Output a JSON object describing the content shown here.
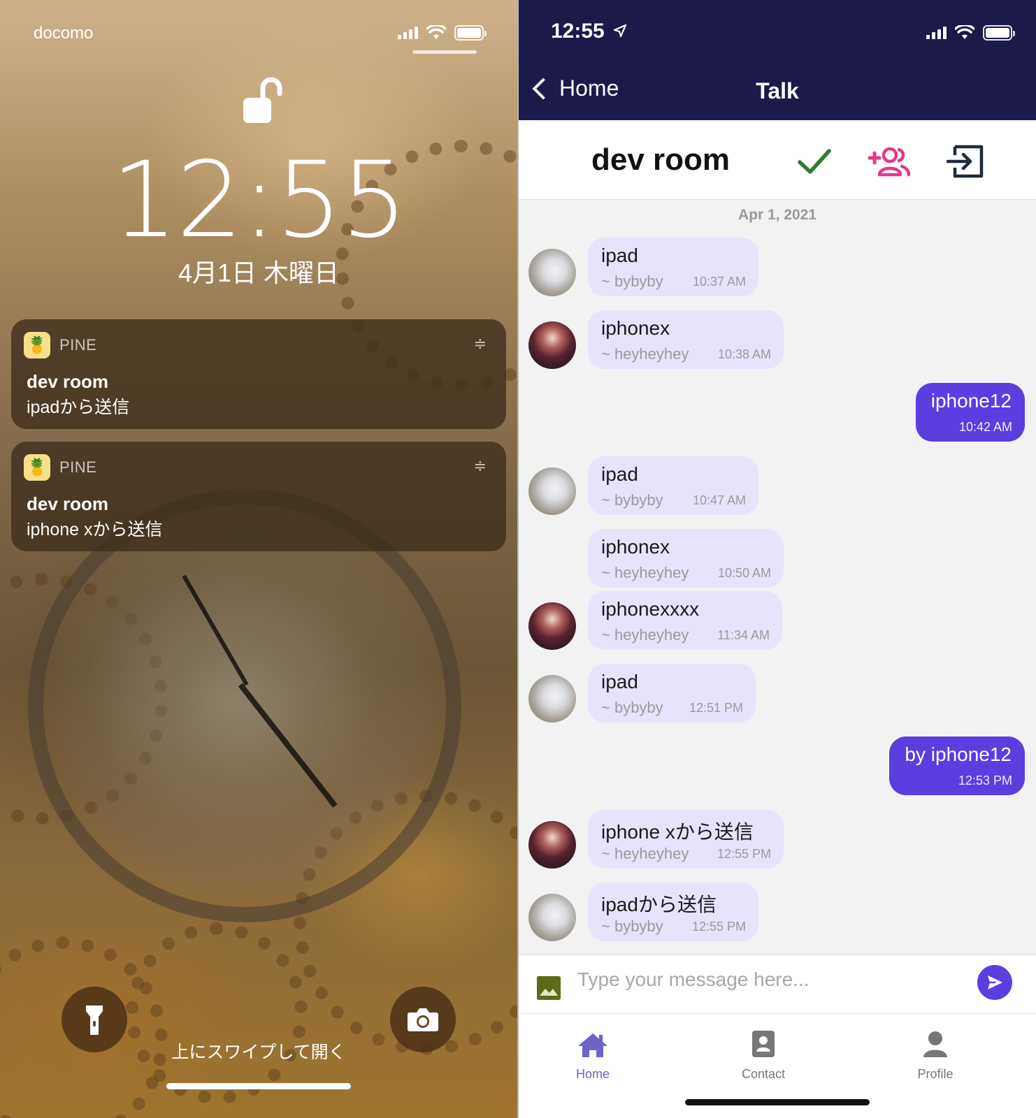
{
  "lock_screen": {
    "carrier": "docomo",
    "time": "12:55",
    "date": "4月1日 木曜日",
    "notifications": [
      {
        "app": "PINE",
        "title": "dev room",
        "body": "ipadから送信"
      },
      {
        "app": "PINE",
        "title": "dev room",
        "body": "iphone xから送信"
      }
    ],
    "swipe_hint": "上にスワイプして開く",
    "icons": {
      "lock": "unlocked-padlock-icon",
      "flashlight": "flashlight-icon",
      "camera": "camera-icon"
    }
  },
  "app": {
    "status_time": "12:55",
    "nav": {
      "back_label": "Home",
      "title": "Talk"
    },
    "room": {
      "name": "dev room",
      "icons": [
        "checkmark-icon",
        "add-users-icon",
        "exit-room-icon"
      ],
      "colors": {
        "check": "#2e7d32",
        "add": "#e03a8a",
        "exit": "#1f2b3a"
      }
    },
    "date_divider": "Apr 1, 2021",
    "messages": [
      {
        "direction": "in",
        "text": "ipad",
        "sender": "~ bybyby",
        "time": "10:37 AM",
        "avatar": "white-creature"
      },
      {
        "direction": "in",
        "text": "iphonex",
        "sender": "~ heyheyhey",
        "time": "10:38 AM",
        "avatar": "anime-girl"
      },
      {
        "direction": "out",
        "text": "iphone12",
        "time": "10:42 AM"
      },
      {
        "direction": "in",
        "text": "ipad",
        "sender": "~ bybyby",
        "time": "10:47 AM",
        "avatar": "white-creature"
      },
      {
        "direction": "in",
        "text": "iphonex",
        "sender": "~ heyheyhey",
        "time": "10:50 AM",
        "avatar": ""
      },
      {
        "direction": "in",
        "text": "iphonexxxx",
        "sender": "~ heyheyhey",
        "time": "11:34 AM",
        "avatar": "anime-girl"
      },
      {
        "direction": "in",
        "text": "ipad",
        "sender": "~ bybyby",
        "time": "12:51 PM",
        "avatar": "white-creature"
      },
      {
        "direction": "out",
        "text": "by iphone12",
        "time": "12:53 PM"
      },
      {
        "direction": "in",
        "text": "iphone xから送信",
        "sender": "~ heyheyhey",
        "time": "12:55 PM",
        "avatar": "anime-girl"
      },
      {
        "direction": "in",
        "text": "ipadから送信",
        "sender": "~ bybyby",
        "time": "12:55 PM",
        "avatar": "white-creature"
      }
    ],
    "input": {
      "placeholder": "Type your message here..."
    },
    "tabs": [
      {
        "label": "Home",
        "icon": "home-icon",
        "active": true
      },
      {
        "label": "Contact",
        "icon": "contact-icon",
        "active": false
      },
      {
        "label": "Profile",
        "icon": "person-icon",
        "active": false
      }
    ],
    "colors": {
      "nav_bg": "#1c1a4a",
      "outgoing_bubble": "#5b3de0",
      "incoming_bubble": "#e6e3fb",
      "accent": "#6d63c8"
    }
  }
}
